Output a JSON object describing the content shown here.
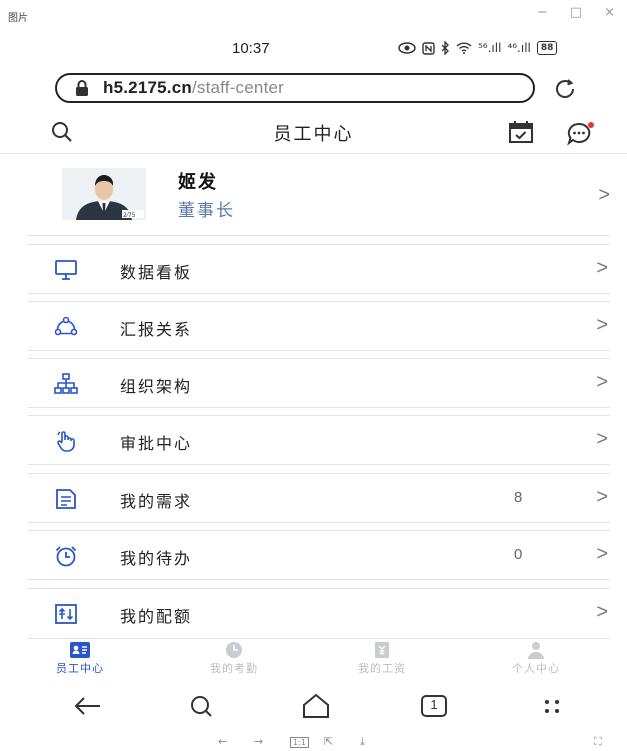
{
  "window": {
    "title": "图片",
    "minimize": "−",
    "maximize": "□",
    "close": "×"
  },
  "status": {
    "time": "10:37",
    "signal1": "⁵⁶.ıll",
    "signal2": "⁴⁶.ıll",
    "battery": "88"
  },
  "browser": {
    "url_host": "h5.2175.cn",
    "url_path": "/staff-center"
  },
  "header": {
    "title": "员工中心",
    "notification_color": "#e53935"
  },
  "profile": {
    "name": "姬发",
    "role": "董事长",
    "badge": "2⁄75"
  },
  "menu": [
    {
      "label": "数据看板",
      "count": "",
      "icon": "monitor-icon"
    },
    {
      "label": "汇报关系",
      "count": "",
      "icon": "relationship-icon"
    },
    {
      "label": "组织架构",
      "count": "",
      "icon": "org-chart-icon"
    },
    {
      "label": "审批中心",
      "count": "",
      "icon": "hand-pointer-icon"
    },
    {
      "label": "我的需求",
      "count": "8",
      "icon": "document-icon"
    },
    {
      "label": "我的待办",
      "count": "0",
      "icon": "alarm-clock-icon"
    },
    {
      "label": "我的配额",
      "count": "",
      "icon": "quota-icon"
    }
  ],
  "chevron": ">",
  "tabs": [
    {
      "label": "员工中心",
      "active": true
    },
    {
      "label": "我的考勤",
      "active": false
    },
    {
      "label": "我的工资",
      "active": false
    },
    {
      "label": "个人中心",
      "active": false
    }
  ],
  "colors": {
    "accent": "#2a56c9",
    "icon_blue": "#2a56c9",
    "role_text": "#5a7aa6",
    "inactive": "#bdbdbd"
  },
  "footer": {
    "back": "←",
    "forward": "→",
    "actual_size": "1:1",
    "share": "⇱",
    "download": "⤓",
    "fullscreen": "⛶"
  },
  "nav": {
    "tab_count": "1"
  }
}
